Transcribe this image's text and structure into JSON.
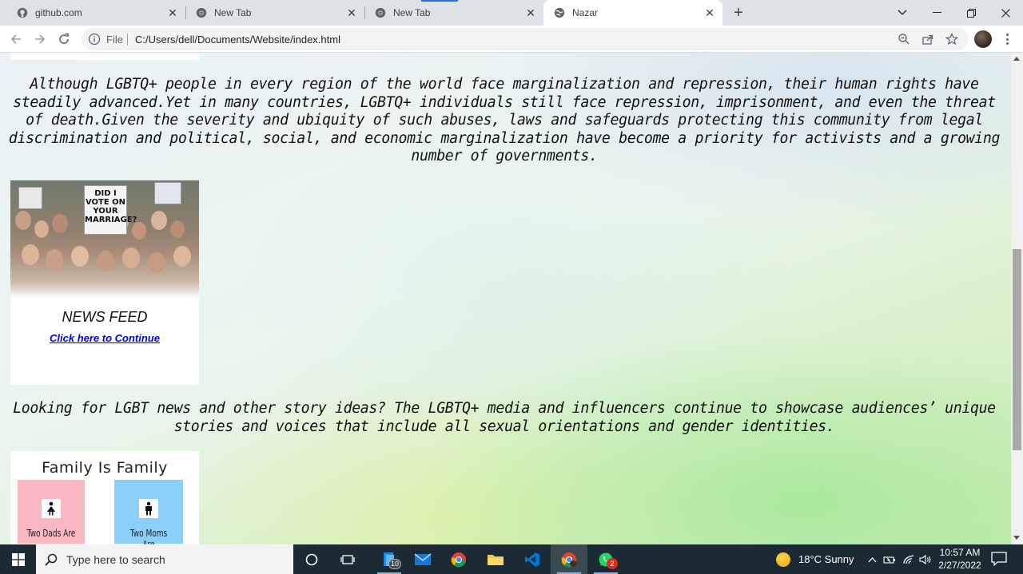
{
  "browser": {
    "tabs": [
      {
        "title": "github.com",
        "icon": "github-icon",
        "active": false
      },
      {
        "title": "New Tab",
        "icon": "chrome-icon",
        "active": false
      },
      {
        "title": "New Tab",
        "icon": "chrome-icon",
        "active": false
      },
      {
        "title": "Nazar",
        "icon": "globe-icon",
        "active": true
      }
    ],
    "new_tab_glyph": "+",
    "close_glyph": "✕",
    "address": {
      "scheme_label": "File",
      "url": "C:/Users/dell/Documents/Website/index.html"
    }
  },
  "page": {
    "paragraph_1": "Although LGBTQ+ people in every region of the world face marginalization and repression, their human rights have steadily advanced.Yet in many countries, LGBTQ+ individuals still face repression, imprisonment, and even the threat of death.Given the severity and ubiquity of such abuses, laws and safeguards protecting this community from legal discrimination and political, social, and economic marginalization have become a priority for activists and a growing number of governments.",
    "news_card": {
      "sign_text": "DID I VOTE ON YOUR MARRIAGE?",
      "title": "NEWS FEED",
      "link": "Click here to Continue"
    },
    "paragraph_2": "Looking for LGBT news and other story ideas? The LGBTQ+ media and influencers continue to showcase audiences’ unique stories and voices that include all sexual orientations and gender identities.",
    "family_card": {
      "title": "Family Is Family",
      "left_caption": "Two Dads Are",
      "right_caption": "Two Moms Are",
      "left_color": "#f8b7c1",
      "right_color": "#8ccff8"
    }
  },
  "taskbar": {
    "search_placeholder": "Type here to search",
    "explorer_badge": "10",
    "whatsapp_badge": "2",
    "weather": "18°C  Sunny",
    "time": "10:57 AM",
    "date": "2/27/2022"
  },
  "colors": {
    "tabstrip": "#dee1e6",
    "taskbar": "#1c2b33",
    "link": "#0000ee"
  }
}
